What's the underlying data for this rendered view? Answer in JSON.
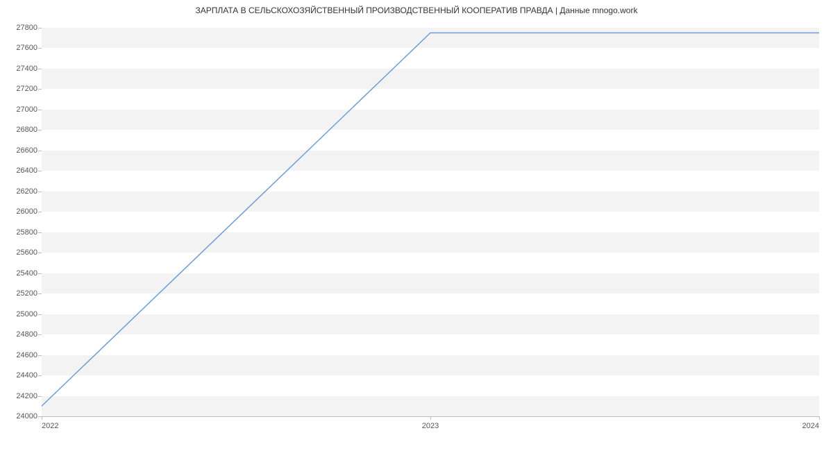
{
  "chart_data": {
    "type": "line",
    "title": "ЗАРПЛАТА В СЕЛЬСКОХОЗЯЙСТВЕННЫЙ ПРОИЗВОДСТВЕННЫЙ КООПЕРАТИВ  ПРАВДА | Данные mnogo.work",
    "xlabel": "",
    "ylabel": "",
    "x": [
      2022,
      2023,
      2024
    ],
    "values": [
      24100,
      27750,
      27750
    ],
    "x_ticks": [
      2022,
      2023,
      2024
    ],
    "y_ticks": [
      24000,
      24200,
      24400,
      24600,
      24800,
      25000,
      25200,
      25400,
      25600,
      25800,
      26000,
      26200,
      26400,
      26600,
      26800,
      27000,
      27200,
      27400,
      27600,
      27800
    ],
    "ylim": [
      24000,
      27800
    ],
    "xlim": [
      2022,
      2024
    ],
    "line_color": "#6f9bd8",
    "band_color": "#f3f3f3"
  }
}
